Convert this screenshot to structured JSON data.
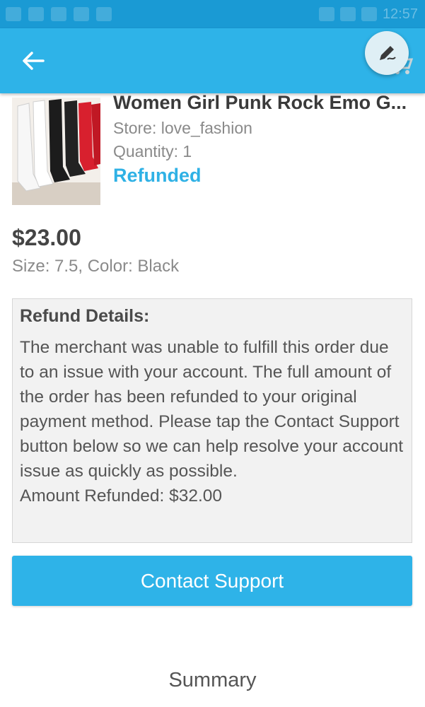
{
  "status_bar": {
    "time": "12:57"
  },
  "toolbar": {
    "back_icon": "back-arrow-icon",
    "edit_icon": "edit-pen-icon"
  },
  "product": {
    "title": "Women Girl Punk Rock Emo G...",
    "store": "Store: love_fashion",
    "quantity": "Quantity: 1",
    "status": "Refunded",
    "price": "$23.00",
    "variant": "Size: 7.5, Color: Black"
  },
  "refund": {
    "title": "Refund Details:",
    "message": "The merchant was unable to fulfill this order due to an issue with your account. The full amount of the order has been refunded to your original payment method. Please tap the Contact Support button below so we can help resolve your account issue as quickly as possible.",
    "amount": "Amount Refunded: $32.00"
  },
  "actions": {
    "contact_support": "Contact Support"
  },
  "summary_label": "Summary",
  "colors": {
    "primary": "#2eb3e8",
    "status_bar": "#1a9ad4",
    "refunded": "#2fb1e5"
  }
}
